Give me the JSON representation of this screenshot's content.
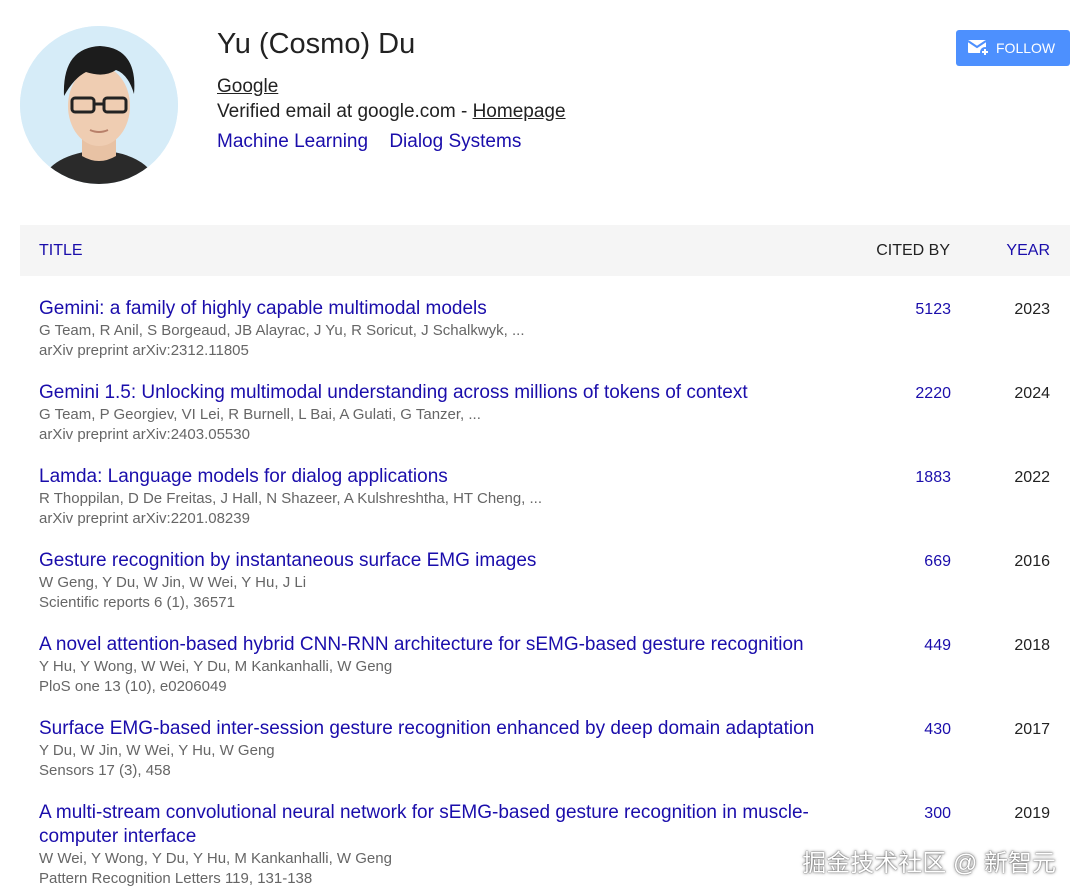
{
  "profile": {
    "name": "Yu (Cosmo) Du",
    "affiliation": "Google",
    "email_text": "Verified email at google.com - ",
    "homepage_label": "Homepage",
    "interests": [
      "Machine Learning",
      "Dialog Systems"
    ]
  },
  "follow_button": {
    "label": "FOLLOW",
    "color": "#4d90fe"
  },
  "table": {
    "header_title": "TITLE",
    "header_cited": "CITED BY",
    "header_year": "YEAR"
  },
  "papers": [
    {
      "title": "Gemini: a family of highly capable multimodal models",
      "authors": "G Team, R Anil, S Borgeaud, JB Alayrac, J Yu, R Soricut, J Schalkwyk, ...",
      "venue": "arXiv preprint arXiv:2312.11805",
      "cited": "5123",
      "year": "2023"
    },
    {
      "title": "Gemini 1.5: Unlocking multimodal understanding across millions of tokens of context",
      "authors": "G Team, P Georgiev, VI Lei, R Burnell, L Bai, A Gulati, G Tanzer, ...",
      "venue": "arXiv preprint arXiv:2403.05530",
      "cited": "2220",
      "year": "2024"
    },
    {
      "title": "Lamda: Language models for dialog applications",
      "authors": "R Thoppilan, D De Freitas, J Hall, N Shazeer, A Kulshreshtha, HT Cheng, ...",
      "venue": "arXiv preprint arXiv:2201.08239",
      "cited": "1883",
      "year": "2022"
    },
    {
      "title": "Gesture recognition by instantaneous surface EMG images",
      "authors": "W Geng, Y Du, W Jin, W Wei, Y Hu, J Li",
      "venue": "Scientific reports 6 (1), 36571",
      "cited": "669",
      "year": "2016"
    },
    {
      "title": "A novel attention-based hybrid CNN-RNN architecture for sEMG-based gesture recognition",
      "authors": "Y Hu, Y Wong, W Wei, Y Du, M Kankanhalli, W Geng",
      "venue": "PloS one 13 (10), e0206049",
      "cited": "449",
      "year": "2018"
    },
    {
      "title": "Surface EMG-based inter-session gesture recognition enhanced by deep domain adaptation",
      "authors": "Y Du, W Jin, W Wei, Y Hu, W Geng",
      "venue": "Sensors 17 (3), 458",
      "cited": "430",
      "year": "2017"
    },
    {
      "title": "A multi-stream convolutional neural network for sEMG-based gesture recognition in muscle-computer interface",
      "authors": "W Wei, Y Wong, Y Du, Y Hu, M Kankanhalli, W Geng",
      "venue": "Pattern Recognition Letters 119, 131-138",
      "cited": "300",
      "year": "2019"
    }
  ],
  "watermark": "掘金技术社区 @ 新智元"
}
